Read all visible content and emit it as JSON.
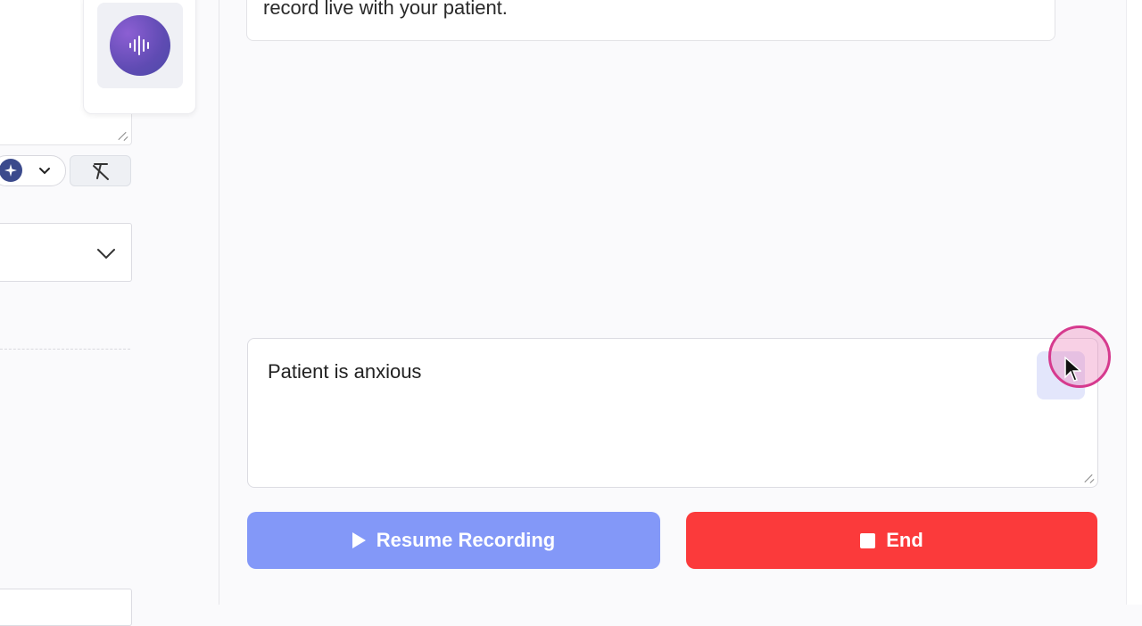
{
  "recording": {
    "instruction_text": "record live with your patient.",
    "notes_value": "Patient is anxious",
    "resume_label": "Resume Recording",
    "end_label": "End"
  },
  "icons": {
    "mic_orb": "audio-waveform-icon",
    "ai_badge": "sparkle-icon",
    "clear_format": "clear-formatting-icon",
    "play": "play-icon",
    "stop": "stop-icon"
  },
  "colors": {
    "resume_button": "#8398f8",
    "end_button": "#fb3a3b",
    "mic_orb": "#5f4bb3",
    "cursor_highlight": "#d63a8e"
  }
}
